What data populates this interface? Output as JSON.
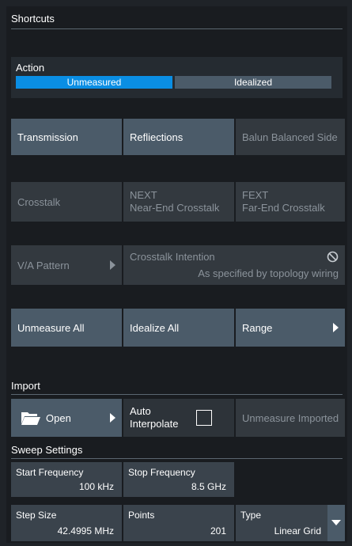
{
  "shortcuts": {
    "title": "Shortcuts",
    "action": {
      "label": "Action",
      "options": [
        "Unmeasured",
        "Idealized"
      ],
      "selected": "Unmeasured"
    },
    "buttons": {
      "transmission": "Transmission",
      "reflections": "Refliections",
      "balun": "Balun Balanced Side",
      "crosstalk": "Crosstalk",
      "next_line1": "NEXT",
      "next_line2": "Near-End Crosstalk",
      "fext_line1": "FEXT",
      "fext_line2": "Far-End Crosstalk",
      "va_pattern": "V/A Pattern",
      "crosstalk_intention_title": "Crosstalk Intention",
      "crosstalk_intention_value": "As specified by topology wiring",
      "unmeasure_all": "Unmeasure All",
      "idealize_all": "Idealize All",
      "range": "Range"
    }
  },
  "import": {
    "title": "Import",
    "open": "Open",
    "auto_line1": "Auto",
    "auto_line2": "Interpolate",
    "auto_checked": false,
    "unmeasure_imported": "Unmeasure Imported"
  },
  "sweep": {
    "title": "Sweep Settings",
    "start_label": "Start Frequency",
    "start_value": "100 kHz",
    "stop_label": "Stop Frequency",
    "stop_value": "8.5 GHz",
    "step_label": "Step Size",
    "step_value": "42.4995 MHz",
    "points_label": "Points",
    "points_value": "201",
    "type_label": "Type",
    "type_value": "Linear Grid"
  },
  "colors": {
    "selected": "#0a8ee4",
    "button": "#4b5b69",
    "disabled": "#33393f"
  }
}
